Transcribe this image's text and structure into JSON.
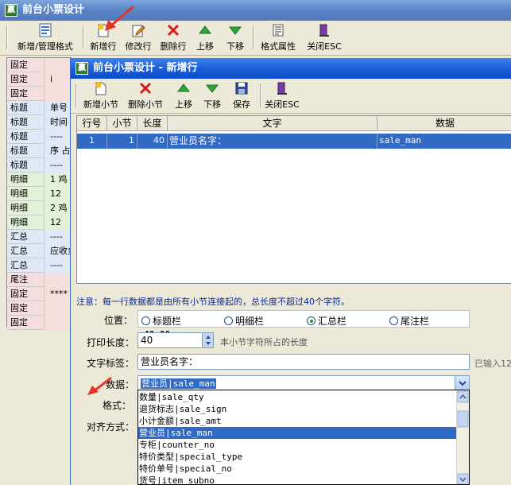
{
  "main_window": {
    "title": "前台小票设计",
    "toolbar": [
      {
        "label": "新增/管理格式",
        "icon": "form-icon"
      },
      {
        "label": "新增行",
        "icon": "new-doc-icon"
      },
      {
        "label": "修改行",
        "icon": "edit-icon"
      },
      {
        "label": "删除行",
        "icon": "delete-icon"
      },
      {
        "label": "上移",
        "icon": "arrow-up-icon"
      },
      {
        "label": "下移",
        "icon": "arrow-down-icon"
      },
      {
        "label": "格式属性",
        "icon": "properties-icon"
      },
      {
        "label": "关闭ESC",
        "icon": "exit-door-icon"
      }
    ],
    "rows": [
      {
        "type": "固定",
        "text": ""
      },
      {
        "type": "固定",
        "text": "i"
      },
      {
        "type": "固定",
        "text": ""
      },
      {
        "type": "标题",
        "text": "单号"
      },
      {
        "type": "标题",
        "text": "时间"
      },
      {
        "type": "标题",
        "text": "----"
      },
      {
        "type": "标题",
        "text": "序 占"
      },
      {
        "type": "标题",
        "text": "----"
      },
      {
        "type": "明细",
        "text": "1 鸡"
      },
      {
        "type": "明细",
        "text": "12"
      },
      {
        "type": "明细",
        "text": "2 鸡"
      },
      {
        "type": "明细",
        "text": "12"
      },
      {
        "type": "汇总",
        "text": "----"
      },
      {
        "type": "汇总",
        "text": "应收金"
      },
      {
        "type": "汇总",
        "text": "----"
      },
      {
        "type": "尾注",
        "text": ""
      },
      {
        "type": "固定",
        "text": "****"
      },
      {
        "type": "固定",
        "text": ""
      },
      {
        "type": "固定",
        "text": ""
      }
    ]
  },
  "dialog": {
    "title": "前台小票设计 - 新增行",
    "toolbar": [
      {
        "label": "新增小节",
        "icon": "new-doc-icon"
      },
      {
        "label": "删除小节",
        "icon": "delete-icon"
      },
      {
        "label": "上移",
        "icon": "arrow-up-icon"
      },
      {
        "label": "下移",
        "icon": "arrow-down-icon"
      },
      {
        "label": "保存",
        "icon": "save-icon"
      },
      {
        "label": "关闭ESC",
        "icon": "exit-door-icon"
      }
    ],
    "grid": {
      "headers": [
        "行号",
        "小节",
        "长度",
        "文字",
        "数据"
      ],
      "rows": [
        {
          "row": "1",
          "section": "1",
          "length": "40",
          "text": "营业员名字：",
          "data": "sale_man"
        }
      ],
      "total": "40.00"
    },
    "note": "注意：每一行数据都是由所有小节连接起的，总长度不超过40个字符。",
    "position": {
      "label": "位置：",
      "options": [
        "标题栏",
        "明细栏",
        "汇总栏",
        "尾注栏"
      ],
      "selected": "汇总栏"
    },
    "print_length": {
      "label": "打印长度：",
      "value": "40",
      "hint": "本小节字符所占的长度"
    },
    "text_label": {
      "label": "文字标签：",
      "value": "营业员名字：",
      "hint": "已输入12"
    },
    "data_field": {
      "label": "数据：",
      "value": "营业员|sale_man",
      "options": [
        "数量|sale_qty",
        "退货标志|sale_sign",
        "小计金额|sale_amt",
        "营业员|sale_man",
        "专柜|counter_no",
        "特价类型|special_type",
        "特价单号|special_no",
        "货号|item_subno"
      ],
      "highlighted": 3
    },
    "format_label": "格式：",
    "align_label": "对齐方式："
  }
}
